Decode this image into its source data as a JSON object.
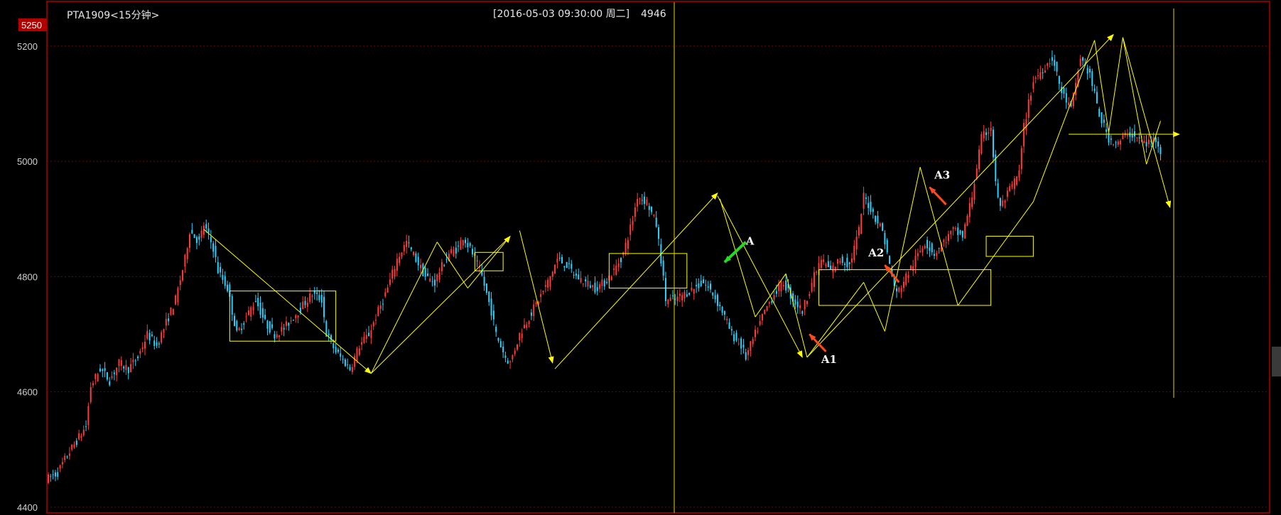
{
  "header": {
    "instrument": "PTA1909<15分钟>",
    "cursor_time": "[2016-05-03  09:30:00 周二]",
    "cursor_value": "4946",
    "price_flag": "5250"
  },
  "chart_data": {
    "type": "candlestick",
    "title": "PTA1909<15分钟>",
    "y_ticks": [
      4400,
      4600,
      4800,
      5000,
      5200
    ],
    "ylim": [
      4390,
      5275
    ],
    "grid": "dotted-red-horizontal",
    "colors": {
      "background": "#000000",
      "up": "#ff3b3b",
      "down": "#29d3ff",
      "grid": "#7a0000",
      "border": "#b00000",
      "annotation": "#ffff00",
      "arrow_red": "#ff4a1a",
      "arrow_green": "#22dd22",
      "cursor_line": "#e0d000"
    },
    "price_path": [
      [
        0,
        4450
      ],
      [
        4,
        4460
      ],
      [
        8,
        4490
      ],
      [
        12,
        4515
      ],
      [
        16,
        4540
      ],
      [
        18,
        4610
      ],
      [
        22,
        4640
      ],
      [
        26,
        4620
      ],
      [
        30,
        4650
      ],
      [
        34,
        4640
      ],
      [
        38,
        4660
      ],
      [
        42,
        4700
      ],
      [
        46,
        4680
      ],
      [
        50,
        4720
      ],
      [
        54,
        4760
      ],
      [
        58,
        4830
      ],
      [
        60,
        4880
      ],
      [
        64,
        4860
      ],
      [
        66,
        4890
      ],
      [
        70,
        4850
      ],
      [
        72,
        4810
      ],
      [
        76,
        4780
      ],
      [
        78,
        4740
      ],
      [
        80,
        4700
      ],
      [
        84,
        4730
      ],
      [
        88,
        4760
      ],
      [
        92,
        4720
      ],
      [
        96,
        4700
      ],
      [
        100,
        4710
      ],
      [
        104,
        4730
      ],
      [
        108,
        4750
      ],
      [
        112,
        4770
      ],
      [
        116,
        4760
      ],
      [
        118,
        4700
      ],
      [
        122,
        4670
      ],
      [
        126,
        4650
      ],
      [
        128,
        4640
      ],
      [
        132,
        4680
      ],
      [
        136,
        4700
      ],
      [
        140,
        4740
      ],
      [
        144,
        4780
      ],
      [
        148,
        4830
      ],
      [
        152,
        4860
      ],
      [
        156,
        4830
      ],
      [
        160,
        4800
      ],
      [
        164,
        4790
      ],
      [
        166,
        4810
      ],
      [
        170,
        4840
      ],
      [
        174,
        4850
      ],
      [
        176,
        4870
      ],
      [
        180,
        4840
      ],
      [
        184,
        4800
      ],
      [
        188,
        4740
      ],
      [
        190,
        4700
      ],
      [
        194,
        4660
      ],
      [
        196,
        4650
      ],
      [
        200,
        4700
      ],
      [
        204,
        4730
      ],
      [
        208,
        4760
      ],
      [
        212,
        4790
      ],
      [
        216,
        4830
      ],
      [
        220,
        4820
      ],
      [
        224,
        4800
      ],
      [
        228,
        4790
      ],
      [
        232,
        4780
      ],
      [
        236,
        4790
      ],
      [
        240,
        4810
      ],
      [
        244,
        4840
      ],
      [
        248,
        4900
      ],
      [
        250,
        4940
      ],
      [
        254,
        4930
      ],
      [
        258,
        4890
      ],
      [
        260,
        4830
      ],
      [
        262,
        4760
      ],
      [
        266,
        4760
      ],
      [
        270,
        4770
      ],
      [
        274,
        4780
      ],
      [
        278,
        4790
      ],
      [
        282,
        4770
      ],
      [
        286,
        4740
      ],
      [
        290,
        4700
      ],
      [
        294,
        4680
      ],
      [
        296,
        4660
      ],
      [
        300,
        4700
      ],
      [
        304,
        4740
      ],
      [
        308,
        4770
      ],
      [
        312,
        4790
      ],
      [
        316,
        4760
      ],
      [
        320,
        4740
      ],
      [
        324,
        4790
      ],
      [
        328,
        4830
      ],
      [
        332,
        4810
      ],
      [
        336,
        4830
      ],
      [
        340,
        4820
      ],
      [
        344,
        4880
      ],
      [
        346,
        4940
      ],
      [
        350,
        4910
      ],
      [
        354,
        4880
      ],
      [
        358,
        4800
      ],
      [
        360,
        4770
      ],
      [
        364,
        4800
      ],
      [
        368,
        4830
      ],
      [
        372,
        4860
      ],
      [
        376,
        4840
      ],
      [
        380,
        4860
      ],
      [
        384,
        4880
      ],
      [
        388,
        4870
      ],
      [
        392,
        4940
      ],
      [
        396,
        5040
      ],
      [
        400,
        5060
      ],
      [
        402,
        4960
      ],
      [
        404,
        4920
      ],
      [
        408,
        4950
      ],
      [
        412,
        4980
      ],
      [
        414,
        5060
      ],
      [
        418,
        5140
      ],
      [
        422,
        5160
      ],
      [
        426,
        5180
      ],
      [
        430,
        5120
      ],
      [
        434,
        5090
      ],
      [
        438,
        5180
      ],
      [
        442,
        5150
      ],
      [
        446,
        5080
      ],
      [
        450,
        5040
      ],
      [
        454,
        5030
      ],
      [
        458,
        5050
      ],
      [
        462,
        5040
      ],
      [
        466,
        5030
      ],
      [
        470,
        5040
      ],
      [
        472,
        5020
      ]
    ],
    "annotations": {
      "boxes": [
        {
          "x1": 77,
          "x2": 122,
          "y1": 4688,
          "y2": 4775
        },
        {
          "x1": 181,
          "x2": 193,
          "y1": 4810,
          "y2": 4842
        },
        {
          "x1": 238,
          "x2": 271,
          "y1": 4780,
          "y2": 4840
        },
        {
          "x1": 327,
          "x2": 400,
          "y1": 4750,
          "y2": 4812
        },
        {
          "x1": 398,
          "x2": 418,
          "y1": 4835,
          "y2": 4870
        }
      ],
      "lines": [
        {
          "x1": 66,
          "y1": 4882,
          "x2": 137,
          "y2": 4632,
          "arrow": true
        },
        {
          "x1": 137,
          "y1": 4632,
          "x2": 165,
          "y2": 4860,
          "arrow": false
        },
        {
          "x1": 165,
          "y1": 4860,
          "x2": 178,
          "y2": 4780,
          "arrow": false
        },
        {
          "x1": 178,
          "y1": 4780,
          "x2": 196,
          "y2": 4870,
          "arrow": true
        },
        {
          "x1": 137,
          "y1": 4632,
          "x2": 196,
          "y2": 4870,
          "arrow": false
        },
        {
          "x1": 200,
          "y1": 4880,
          "x2": 214,
          "y2": 4650,
          "arrow": true
        },
        {
          "x1": 215,
          "y1": 4640,
          "x2": 284,
          "y2": 4945,
          "arrow": true
        },
        {
          "x1": 285,
          "y1": 4935,
          "x2": 300,
          "y2": 4730,
          "arrow": false
        },
        {
          "x1": 300,
          "y1": 4730,
          "x2": 313,
          "y2": 4805,
          "arrow": false
        },
        {
          "x1": 284,
          "y1": 4940,
          "x2": 320,
          "y2": 4660,
          "arrow": true
        },
        {
          "x1": 313,
          "y1": 4805,
          "x2": 322,
          "y2": 4660,
          "arrow": false
        },
        {
          "x1": 322,
          "y1": 4660,
          "x2": 346,
          "y2": 4790,
          "arrow": false
        },
        {
          "x1": 346,
          "y1": 4790,
          "x2": 355,
          "y2": 4705,
          "arrow": false
        },
        {
          "x1": 355,
          "y1": 4705,
          "x2": 370,
          "y2": 4990,
          "arrow": false
        },
        {
          "x1": 370,
          "y1": 4990,
          "x2": 386,
          "y2": 4750,
          "arrow": false
        },
        {
          "x1": 386,
          "y1": 4750,
          "x2": 418,
          "y2": 4930,
          "arrow": false
        },
        {
          "x1": 322,
          "y1": 4660,
          "x2": 452,
          "y2": 5220,
          "arrow": true
        },
        {
          "x1": 418,
          "y1": 4930,
          "x2": 444,
          "y2": 5210,
          "arrow": false
        },
        {
          "x1": 444,
          "y1": 5210,
          "x2": 450,
          "y2": 5050,
          "arrow": false
        },
        {
          "x1": 450,
          "y1": 5050,
          "x2": 456,
          "y2": 5215,
          "arrow": false
        },
        {
          "x1": 456,
          "y1": 5215,
          "x2": 466,
          "y2": 4995,
          "arrow": false
        },
        {
          "x1": 466,
          "y1": 4995,
          "x2": 472,
          "y2": 5070,
          "arrow": false
        },
        {
          "x1": 456,
          "y1": 5215,
          "x2": 476,
          "y2": 4920,
          "arrow": true
        },
        {
          "x1": 433,
          "y1": 5047,
          "x2": 480,
          "y2": 5047,
          "arrow": true
        }
      ],
      "labels": [
        {
          "text": "A",
          "x": 296,
          "y": 4855
        },
        {
          "text": "A1",
          "x": 328,
          "y": 4650
        },
        {
          "text": "A2",
          "x": 348,
          "y": 4835
        },
        {
          "text": "A3",
          "x": 376,
          "y": 4970
        }
      ],
      "red_arrows": [
        {
          "x1": 330,
          "y1": 4670,
          "x2": 323,
          "y2": 4700
        },
        {
          "x1": 361,
          "y1": 4790,
          "x2": 355,
          "y2": 4820
        },
        {
          "x1": 381,
          "y1": 4925,
          "x2": 374,
          "y2": 4955
        }
      ],
      "green_arrows": [
        {
          "x1": 296,
          "y1": 4860,
          "x2": 287,
          "y2": 4825
        }
      ]
    }
  }
}
